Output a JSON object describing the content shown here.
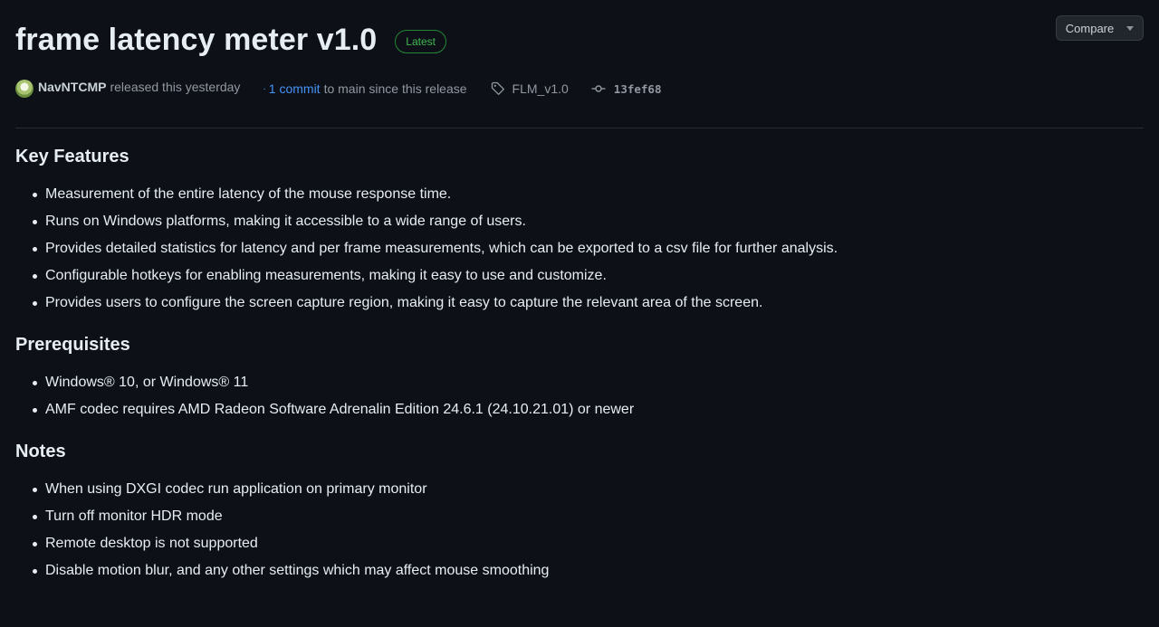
{
  "release": {
    "title": "frame latency meter v1.0",
    "badge": "Latest",
    "compare_label": "Compare",
    "author": "NavNTCMP",
    "released_text": "released this yesterday",
    "commit_dot": "·",
    "commit_link": "1 commit",
    "commit_suffix": "to main since this release",
    "tag": "FLM_v1.0",
    "sha": "13fef68"
  },
  "colors": {
    "background": "#0d1117",
    "accent_link": "#4493f8",
    "badge_green": "#3fb950"
  },
  "sections": [
    {
      "heading": "Key Features",
      "items": [
        "Measurement of the entire latency of the mouse response time.",
        "Runs on Windows platforms, making it accessible to a wide range of users.",
        "Provides detailed statistics for latency and per frame measurements, which can be exported to a csv file for further analysis.",
        "Configurable hotkeys for enabling measurements, making it easy to use and customize.",
        "Provides users to configure the screen capture region, making it easy to capture the relevant area of the screen."
      ]
    },
    {
      "heading": "Prerequisites",
      "items": [
        "Windows® 10, or Windows® 11",
        "AMF codec requires AMD Radeon Software Adrenalin Edition 24.6.1 (24.10.21.01) or newer"
      ]
    },
    {
      "heading": "Notes",
      "items": [
        "When using DXGI codec run application on primary monitor",
        "Turn off monitor HDR mode",
        "Remote desktop is not supported",
        "Disable motion blur, and any other settings which may affect mouse smoothing"
      ]
    }
  ]
}
